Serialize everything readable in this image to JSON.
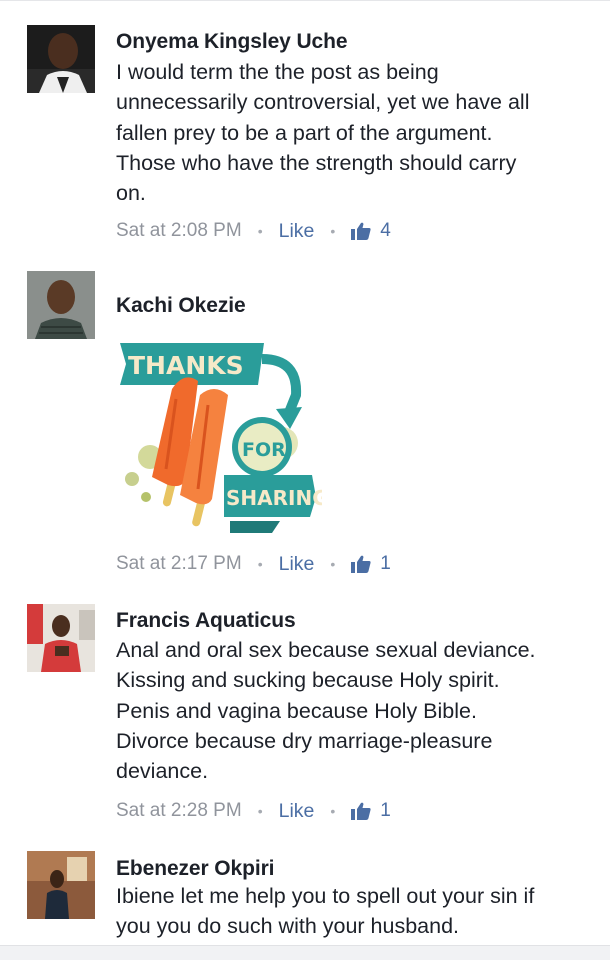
{
  "comments": [
    {
      "author": "Onyema Kingsley Uche",
      "text": "I would term the the post as being\nunnecessarily controversial, yet we have all\nfallen prey to be a part of the argument.\nThose who have the strength should carry\non.",
      "time": "Sat at 2:08 PM",
      "like_label": "Like",
      "like_count": "4"
    },
    {
      "author": "Kachi Okezie",
      "sticker": {
        "line1": "THANKS",
        "line2": "FOR",
        "line3": "SHARING"
      },
      "time": "Sat at 2:17 PM",
      "like_label": "Like",
      "like_count": "1"
    },
    {
      "author": "Francis Aquaticus",
      "text": "Anal and oral sex because sexual deviance.\nKissing and sucking because Holy spirit.\nPenis and vagina because Holy Bible.\nDivorce because dry marriage-pleasure\ndeviance.",
      "time": "Sat at 2:28 PM",
      "like_label": "Like",
      "like_count": "1"
    },
    {
      "author": "Ebenezer Okpiri",
      "text": "Ibiene let me help you to spell out your sin if\nyou you do such with your husband."
    }
  ],
  "colors": {
    "name": "#1d2129",
    "meta": "#90949c",
    "link": "#4b6ea4",
    "sticker_teal": "#2a9d9a",
    "sticker_orange": "#f06a2c"
  },
  "icons": {
    "like": "thumbs-up-icon"
  }
}
